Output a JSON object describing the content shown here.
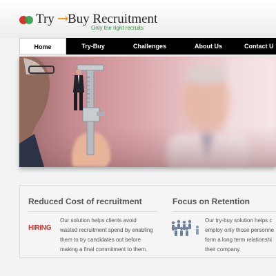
{
  "brand": {
    "name_try": "Try",
    "name_buy": "Buy Recruitment",
    "tagline": "Only the right recruits"
  },
  "nav": {
    "items": [
      "Home",
      "Try-Buy",
      "Challenges",
      "About Us",
      "Contact U"
    ]
  },
  "features": [
    {
      "title": "Reduced Cost of recruitment",
      "icon_label": "HIRING",
      "lines": [
        "Our solution helps clients avoid",
        "wasted recruitment spend by enabling",
        "them to try candidates out before",
        "making a final commitment to them."
      ]
    },
    {
      "title": "Focus on Retention",
      "lines": [
        "Our try-buy solution helps c",
        "employ only those personne",
        "form a long term relationshi",
        "their company."
      ]
    }
  ],
  "colors": {
    "nav_bg": "#000000",
    "tagline": "#2e8b3b",
    "hiring": "#d32f2f",
    "banner_tint": "#c58a8f"
  }
}
